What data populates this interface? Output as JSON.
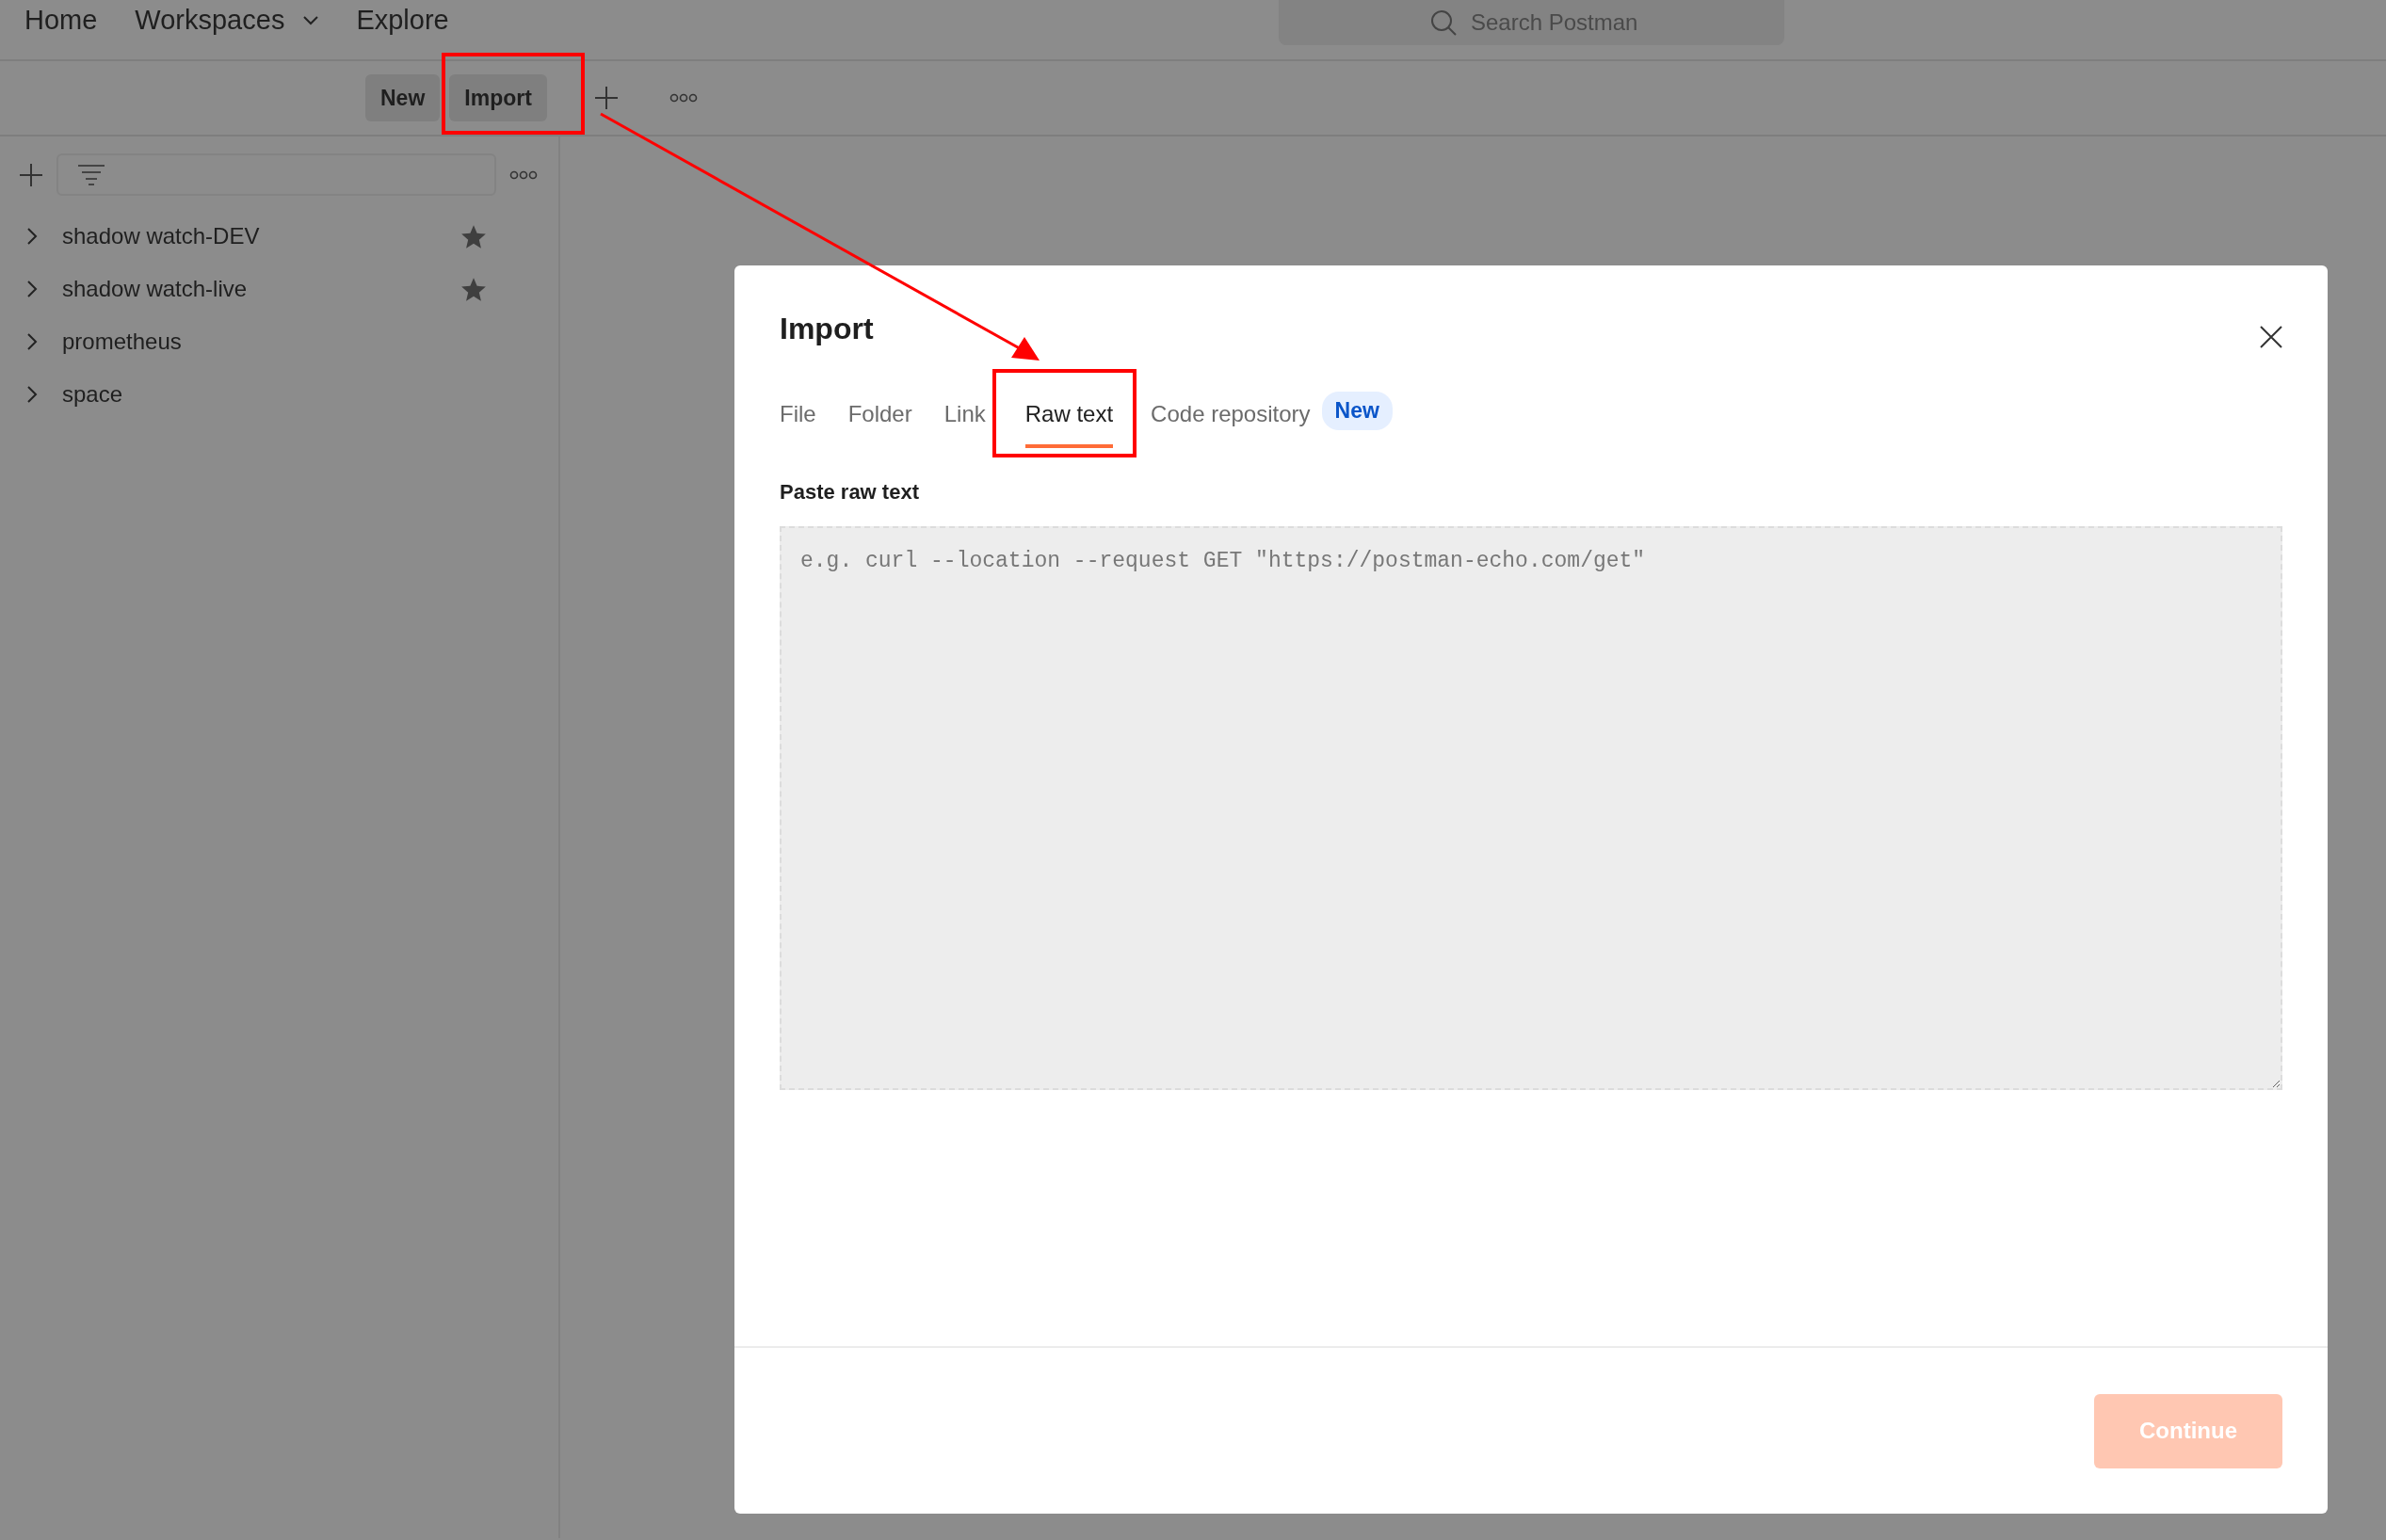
{
  "nav": [
    {
      "label": "Home",
      "dropdown": false
    },
    {
      "label": "Workspaces",
      "dropdown": true
    },
    {
      "label": "Explore",
      "dropdown": false
    }
  ],
  "search": {
    "placeholder": "Search Postman"
  },
  "toolbar": {
    "buttons": [
      "New",
      "Import"
    ]
  },
  "sidebar": {
    "items": [
      {
        "label": "shadow watch-DEV",
        "starred": true
      },
      {
        "label": "shadow watch-live",
        "starred": true
      },
      {
        "label": "prometheus",
        "starred": false
      },
      {
        "label": "space",
        "starred": false
      }
    ]
  },
  "dialog": {
    "title": "Import",
    "tabs": [
      {
        "label": "File",
        "selected": false
      },
      {
        "label": "Folder",
        "selected": false
      },
      {
        "label": "Link",
        "selected": false
      },
      {
        "label": "Raw text",
        "selected": true
      },
      {
        "label": "Code repository",
        "selected": false,
        "badge": "New"
      }
    ],
    "field_label": "Paste raw text",
    "textarea": {
      "placeholder": "e.g. curl --location --request GET \"https://postman-echo.com/get\""
    },
    "continue_button": {
      "label": "Continue",
      "disabled": true
    }
  }
}
